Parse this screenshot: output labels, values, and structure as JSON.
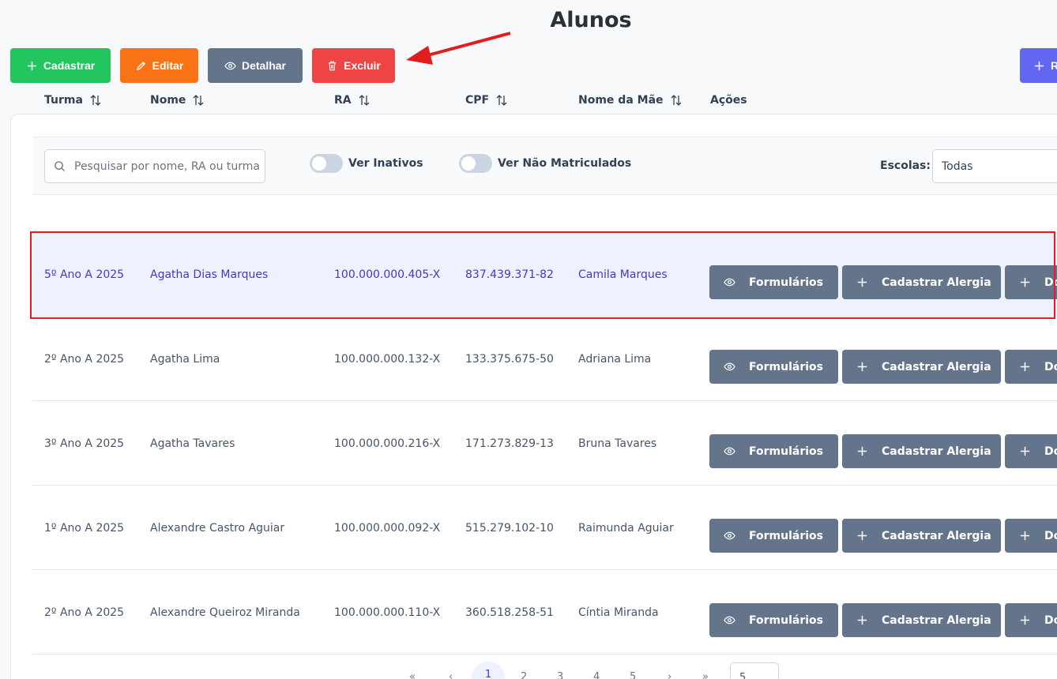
{
  "page": {
    "title": "Alunos"
  },
  "toolbar": {
    "add_label": "Cadastrar",
    "edit_label": "Editar",
    "detail_label": "Detalhar",
    "delete_label": "Excluir",
    "right_label": "R",
    "colors": {
      "add": "#22c55e",
      "edit": "#f97316",
      "detail": "#64748b",
      "delete": "#ef4444",
      "right": "#6366f1"
    }
  },
  "filters": {
    "search_placeholder": "Pesquisar por nome, RA ou turma",
    "inactive_label": "Ver Inativos",
    "unenrolled_label": "Ver Não Matriculados",
    "schools_label": "Escolas:",
    "schools_value": "Todas"
  },
  "table": {
    "headers": [
      "Turma",
      "Nome",
      "RA",
      "CPF",
      "Nome da Mãe",
      "Ações"
    ],
    "actions": {
      "forms": "Formulários",
      "allergy": "Cadastrar Alergia",
      "third": "Do"
    },
    "rows": [
      {
        "turma": "5º Ano A 2025",
        "nome": "Agatha Dias Marques",
        "ra": "100.000.000.405-X",
        "cpf": "837.439.371-82",
        "mae": "Camila Marques"
      },
      {
        "turma": "2º Ano A 2025",
        "nome": "Agatha Lima",
        "ra": "100.000.000.132-X",
        "cpf": "133.375.675-50",
        "mae": "Adriana Lima"
      },
      {
        "turma": "3º Ano A 2025",
        "nome": "Agatha Tavares",
        "ra": "100.000.000.216-X",
        "cpf": "171.273.829-13",
        "mae": "Bruna Tavares"
      },
      {
        "turma": "1º Ano A 2025",
        "nome": "Alexandre Castro Aguiar",
        "ra": "100.000.000.092-X",
        "cpf": "515.279.102-10",
        "mae": "Raimunda Aguiar"
      },
      {
        "turma": "2º Ano A 2025",
        "nome": "Alexandre Queiroz Miranda",
        "ra": "100.000.000.110-X",
        "cpf": "360.518.258-51",
        "mae": "Cíntia Miranda"
      }
    ]
  },
  "pagination": {
    "first": "«",
    "prev": "‹",
    "pages": [
      "1",
      "2",
      "3",
      "4",
      "5"
    ],
    "next": "›",
    "last": "»",
    "rows_per_page": "5"
  }
}
